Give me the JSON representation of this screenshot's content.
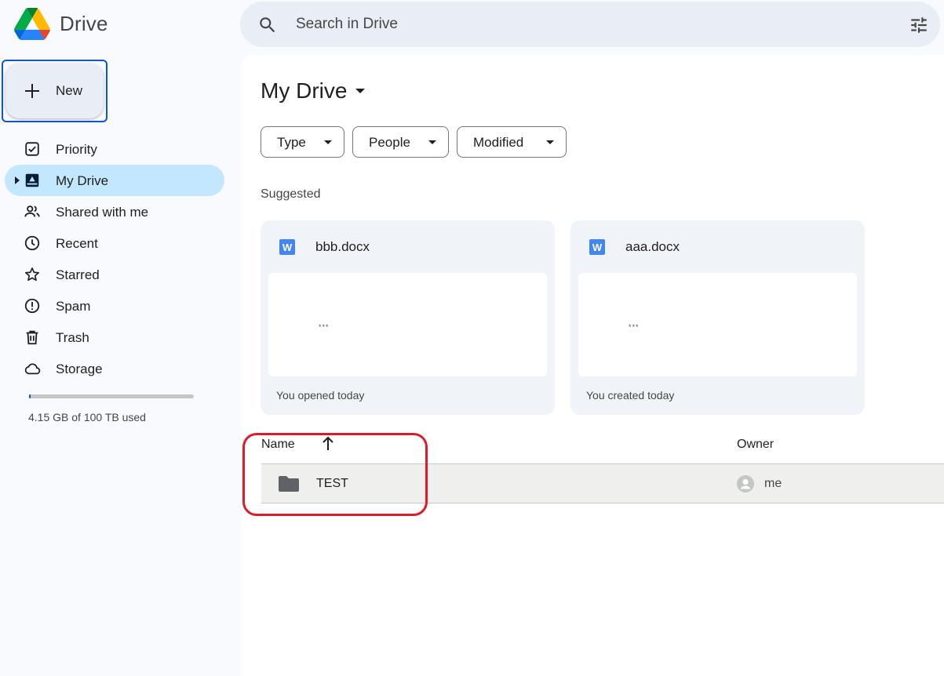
{
  "app": {
    "name": "Drive"
  },
  "search": {
    "placeholder": "Search in Drive"
  },
  "new_button": {
    "label": "New"
  },
  "sidebar": {
    "items": [
      {
        "label": "Priority",
        "icon": "priority-icon"
      },
      {
        "label": "My Drive",
        "icon": "my-drive-icon",
        "active": true
      },
      {
        "label": "Shared with me",
        "icon": "shared-icon"
      },
      {
        "label": "Recent",
        "icon": "clock-icon"
      },
      {
        "label": "Starred",
        "icon": "star-icon"
      },
      {
        "label": "Spam",
        "icon": "spam-icon"
      },
      {
        "label": "Trash",
        "icon": "trash-icon"
      },
      {
        "label": "Storage",
        "icon": "cloud-icon"
      }
    ],
    "storage_text": "4.15 GB of 100 TB used",
    "storage_used_fraction": 0.0001
  },
  "main": {
    "title": "My Drive",
    "filters": [
      "Type",
      "People",
      "Modified"
    ],
    "suggested_label": "Suggested",
    "suggested": [
      {
        "name": "bbb.docx",
        "info": "You opened today",
        "preview_text": "***"
      },
      {
        "name": "aaa.docx",
        "info": "You created today",
        "preview_text": "***"
      }
    ],
    "table": {
      "headers": {
        "name": "Name",
        "owner": "Owner"
      },
      "rows": [
        {
          "name": "TEST",
          "owner": "me"
        }
      ]
    }
  },
  "colors": {
    "accent": "#0b57d0",
    "active_nav": "#c2e7ff",
    "annotation": "#dd1c2a"
  }
}
